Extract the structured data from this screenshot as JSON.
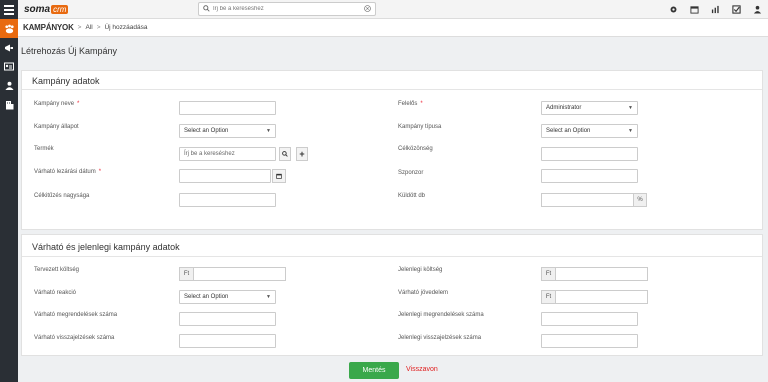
{
  "app": {
    "logo_soma": "soma",
    "logo_crm": "crm"
  },
  "search": {
    "placeholder": "Írj be a kereséshez"
  },
  "breadcrumb": {
    "main": "KAMPÁNYOK",
    "all": "All",
    "current": "Új hozzáadása"
  },
  "page": {
    "title": "Létrehozás Új Kampány"
  },
  "section1": {
    "title": "Kampány adatok",
    "campaign_name": "Kampány neve",
    "campaign_status": "Kampány állapot",
    "status_value": "Select an Option",
    "product": "Termék",
    "product_placeholder": "Írj be a kereséshez",
    "close_date": "Várható lezárási dátum",
    "target_size": "Célkitűzés nagysága",
    "owner": "Felelős",
    "owner_value": "Administrator",
    "campaign_type": "Kampány típusa",
    "type_value": "Select an Option",
    "target_audience": "Célközönség",
    "sponsor": "Szponzor",
    "sent_count": "Küldött db",
    "percent": "%"
  },
  "section2": {
    "title": "Várható és jelenlegi kampány adatok",
    "planned_cost": "Tervezett költség",
    "expected_response": "Várható reakció",
    "response_value": "Select an Option",
    "expected_orders": "Várható megrendelések száma",
    "expected_returns": "Várható visszajelzések száma",
    "current_cost": "Jelenlegi költség",
    "expected_revenue": "Várható jövedelem",
    "current_orders": "Jelenlegi megrendelések száma",
    "current_returns": "Jelenlegi visszajelzések száma",
    "currency": "Ft"
  },
  "actions": {
    "save": "Mentés",
    "cancel": "Visszavon"
  },
  "colors": {
    "accent": "#e86a10",
    "save": "#3aa84b",
    "cancel": "#e02020",
    "sidebar": "#2a2f35"
  },
  "icons": [
    "menu-icon",
    "search-icon",
    "clear-icon",
    "gear-icon",
    "calendar-icon",
    "chart-icon",
    "checkbox-icon",
    "user-icon",
    "megaphone-icon",
    "contact-card-icon",
    "person-icon",
    "building-icon"
  ]
}
